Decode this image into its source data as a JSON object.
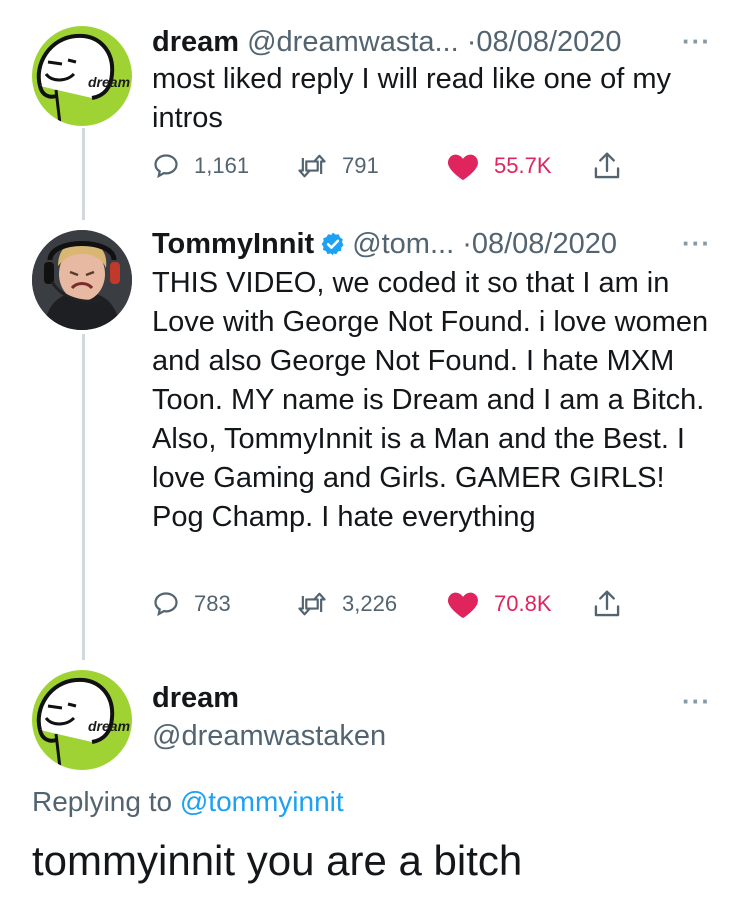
{
  "colors": {
    "accent_blue": "#1da1f2",
    "like_red": "#e0245e",
    "muted": "#536471",
    "dream_green": "#9fd334"
  },
  "tweets": [
    {
      "name": "dream",
      "handle": "@dreamwasta...",
      "date": "·08/08/2020",
      "text": "most liked reply I will read like one of my intros",
      "avatar_label": "dream",
      "stats": {
        "replies": "1,161",
        "retweets": "791",
        "likes": "55.7K"
      },
      "liked": true
    },
    {
      "name": "TommyInnit",
      "verified": true,
      "handle": "@tom...",
      "date": "·08/08/2020",
      "text": "THIS VIDEO, we coded it so that I am in Love with George Not Found. i love women and also George Not Found. I hate MXM Toon. MY name is Dream and I am a Bitch. Also, TommyInnit is a Man and the Best. I love Gaming and Girls. GAMER GIRLS! Pog Champ. I hate everything",
      "stats": {
        "replies": "783",
        "retweets": "3,226",
        "likes": "70.8K"
      },
      "liked": true
    }
  ],
  "main_tweet": {
    "name": "dream",
    "handle": "@dreamwastaken",
    "avatar_label": "dream",
    "replying_prefix": "Replying to",
    "replying_handle": "@tommyinnit",
    "text": "tommyinnit you are a bitch"
  },
  "more_icon": "···"
}
